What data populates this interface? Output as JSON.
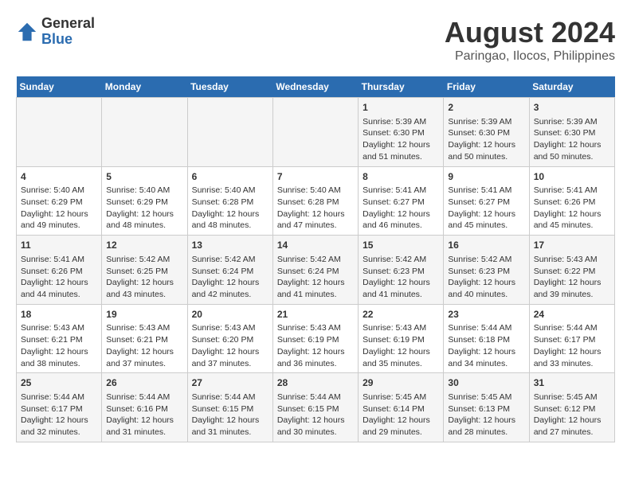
{
  "logo": {
    "general": "General",
    "blue": "Blue"
  },
  "title": "August 2024",
  "subtitle": "Paringao, Ilocos, Philippines",
  "days_of_week": [
    "Sunday",
    "Monday",
    "Tuesday",
    "Wednesday",
    "Thursday",
    "Friday",
    "Saturday"
  ],
  "weeks": [
    [
      {
        "day": "",
        "info": ""
      },
      {
        "day": "",
        "info": ""
      },
      {
        "day": "",
        "info": ""
      },
      {
        "day": "",
        "info": ""
      },
      {
        "day": "1",
        "info": "Sunrise: 5:39 AM\nSunset: 6:30 PM\nDaylight: 12 hours and 51 minutes."
      },
      {
        "day": "2",
        "info": "Sunrise: 5:39 AM\nSunset: 6:30 PM\nDaylight: 12 hours and 50 minutes."
      },
      {
        "day": "3",
        "info": "Sunrise: 5:39 AM\nSunset: 6:30 PM\nDaylight: 12 hours and 50 minutes."
      }
    ],
    [
      {
        "day": "4",
        "info": "Sunrise: 5:40 AM\nSunset: 6:29 PM\nDaylight: 12 hours and 49 minutes."
      },
      {
        "day": "5",
        "info": "Sunrise: 5:40 AM\nSunset: 6:29 PM\nDaylight: 12 hours and 48 minutes."
      },
      {
        "day": "6",
        "info": "Sunrise: 5:40 AM\nSunset: 6:28 PM\nDaylight: 12 hours and 48 minutes."
      },
      {
        "day": "7",
        "info": "Sunrise: 5:40 AM\nSunset: 6:28 PM\nDaylight: 12 hours and 47 minutes."
      },
      {
        "day": "8",
        "info": "Sunrise: 5:41 AM\nSunset: 6:27 PM\nDaylight: 12 hours and 46 minutes."
      },
      {
        "day": "9",
        "info": "Sunrise: 5:41 AM\nSunset: 6:27 PM\nDaylight: 12 hours and 45 minutes."
      },
      {
        "day": "10",
        "info": "Sunrise: 5:41 AM\nSunset: 6:26 PM\nDaylight: 12 hours and 45 minutes."
      }
    ],
    [
      {
        "day": "11",
        "info": "Sunrise: 5:41 AM\nSunset: 6:26 PM\nDaylight: 12 hours and 44 minutes."
      },
      {
        "day": "12",
        "info": "Sunrise: 5:42 AM\nSunset: 6:25 PM\nDaylight: 12 hours and 43 minutes."
      },
      {
        "day": "13",
        "info": "Sunrise: 5:42 AM\nSunset: 6:24 PM\nDaylight: 12 hours and 42 minutes."
      },
      {
        "day": "14",
        "info": "Sunrise: 5:42 AM\nSunset: 6:24 PM\nDaylight: 12 hours and 41 minutes."
      },
      {
        "day": "15",
        "info": "Sunrise: 5:42 AM\nSunset: 6:23 PM\nDaylight: 12 hours and 41 minutes."
      },
      {
        "day": "16",
        "info": "Sunrise: 5:42 AM\nSunset: 6:23 PM\nDaylight: 12 hours and 40 minutes."
      },
      {
        "day": "17",
        "info": "Sunrise: 5:43 AM\nSunset: 6:22 PM\nDaylight: 12 hours and 39 minutes."
      }
    ],
    [
      {
        "day": "18",
        "info": "Sunrise: 5:43 AM\nSunset: 6:21 PM\nDaylight: 12 hours and 38 minutes."
      },
      {
        "day": "19",
        "info": "Sunrise: 5:43 AM\nSunset: 6:21 PM\nDaylight: 12 hours and 37 minutes."
      },
      {
        "day": "20",
        "info": "Sunrise: 5:43 AM\nSunset: 6:20 PM\nDaylight: 12 hours and 37 minutes."
      },
      {
        "day": "21",
        "info": "Sunrise: 5:43 AM\nSunset: 6:19 PM\nDaylight: 12 hours and 36 minutes."
      },
      {
        "day": "22",
        "info": "Sunrise: 5:43 AM\nSunset: 6:19 PM\nDaylight: 12 hours and 35 minutes."
      },
      {
        "day": "23",
        "info": "Sunrise: 5:44 AM\nSunset: 6:18 PM\nDaylight: 12 hours and 34 minutes."
      },
      {
        "day": "24",
        "info": "Sunrise: 5:44 AM\nSunset: 6:17 PM\nDaylight: 12 hours and 33 minutes."
      }
    ],
    [
      {
        "day": "25",
        "info": "Sunrise: 5:44 AM\nSunset: 6:17 PM\nDaylight: 12 hours and 32 minutes."
      },
      {
        "day": "26",
        "info": "Sunrise: 5:44 AM\nSunset: 6:16 PM\nDaylight: 12 hours and 31 minutes."
      },
      {
        "day": "27",
        "info": "Sunrise: 5:44 AM\nSunset: 6:15 PM\nDaylight: 12 hours and 31 minutes."
      },
      {
        "day": "28",
        "info": "Sunrise: 5:44 AM\nSunset: 6:15 PM\nDaylight: 12 hours and 30 minutes."
      },
      {
        "day": "29",
        "info": "Sunrise: 5:45 AM\nSunset: 6:14 PM\nDaylight: 12 hours and 29 minutes."
      },
      {
        "day": "30",
        "info": "Sunrise: 5:45 AM\nSunset: 6:13 PM\nDaylight: 12 hours and 28 minutes."
      },
      {
        "day": "31",
        "info": "Sunrise: 5:45 AM\nSunset: 6:12 PM\nDaylight: 12 hours and 27 minutes."
      }
    ]
  ]
}
